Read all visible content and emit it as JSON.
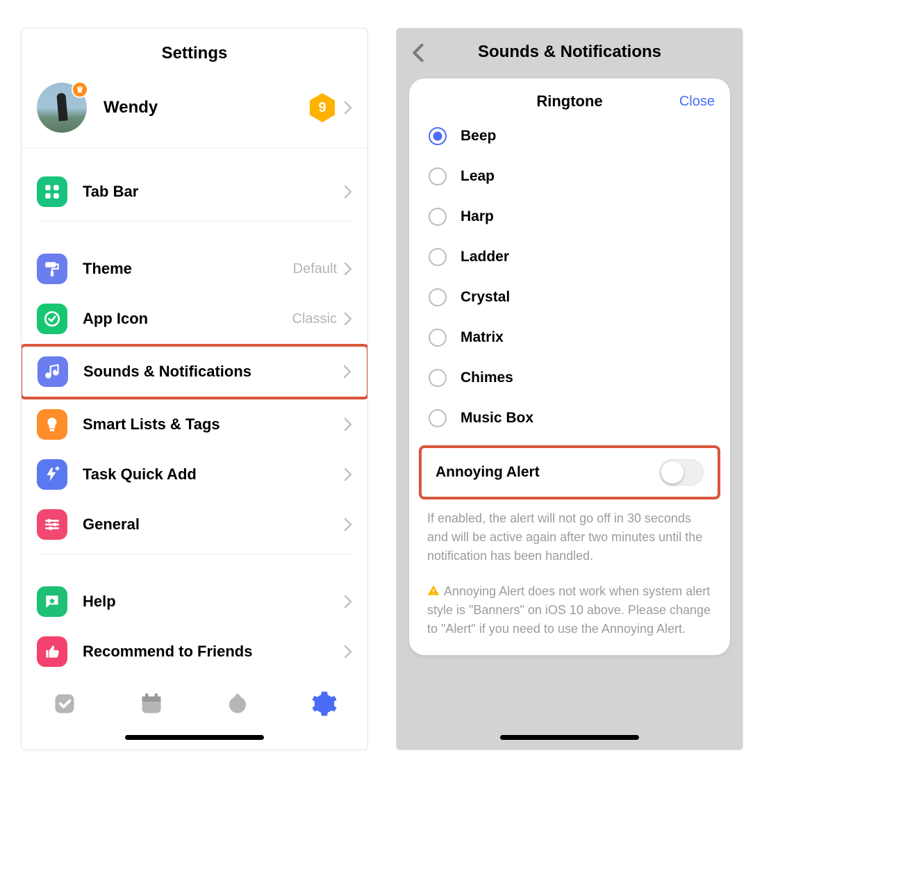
{
  "left": {
    "title": "Settings",
    "profile": {
      "name": "Wendy",
      "level_badge": "9"
    },
    "rows": {
      "tabbar": "Tab Bar",
      "theme": {
        "label": "Theme",
        "value": "Default"
      },
      "appicon": {
        "label": "App Icon",
        "value": "Classic"
      },
      "sounds": "Sounds & Notifications",
      "smartlists": "Smart Lists & Tags",
      "quickadd": "Task Quick Add",
      "general": "General",
      "help": "Help",
      "recommend": "Recommend to Friends"
    }
  },
  "right": {
    "nav_title": "Sounds & Notifications",
    "card_title": "Ringtone",
    "close": "Close",
    "options": [
      {
        "label": "Beep",
        "checked": true
      },
      {
        "label": "Leap",
        "checked": false
      },
      {
        "label": "Harp",
        "checked": false
      },
      {
        "label": "Ladder",
        "checked": false
      },
      {
        "label": "Crystal",
        "checked": false
      },
      {
        "label": "Matrix",
        "checked": false
      },
      {
        "label": "Chimes",
        "checked": false
      },
      {
        "label": "Music Box",
        "checked": false
      }
    ],
    "toggle": {
      "label": "Annoying Alert",
      "on": false
    },
    "desc1": "If enabled, the alert will not go off in 30 seconds and will be active again after two minutes until the notification has been handled.",
    "desc2": "Annoying Alert does not work when system alert style is \"Banners\" on iOS 10 above. Please change to \"Alert\" if you need to use the Annoying Alert."
  }
}
